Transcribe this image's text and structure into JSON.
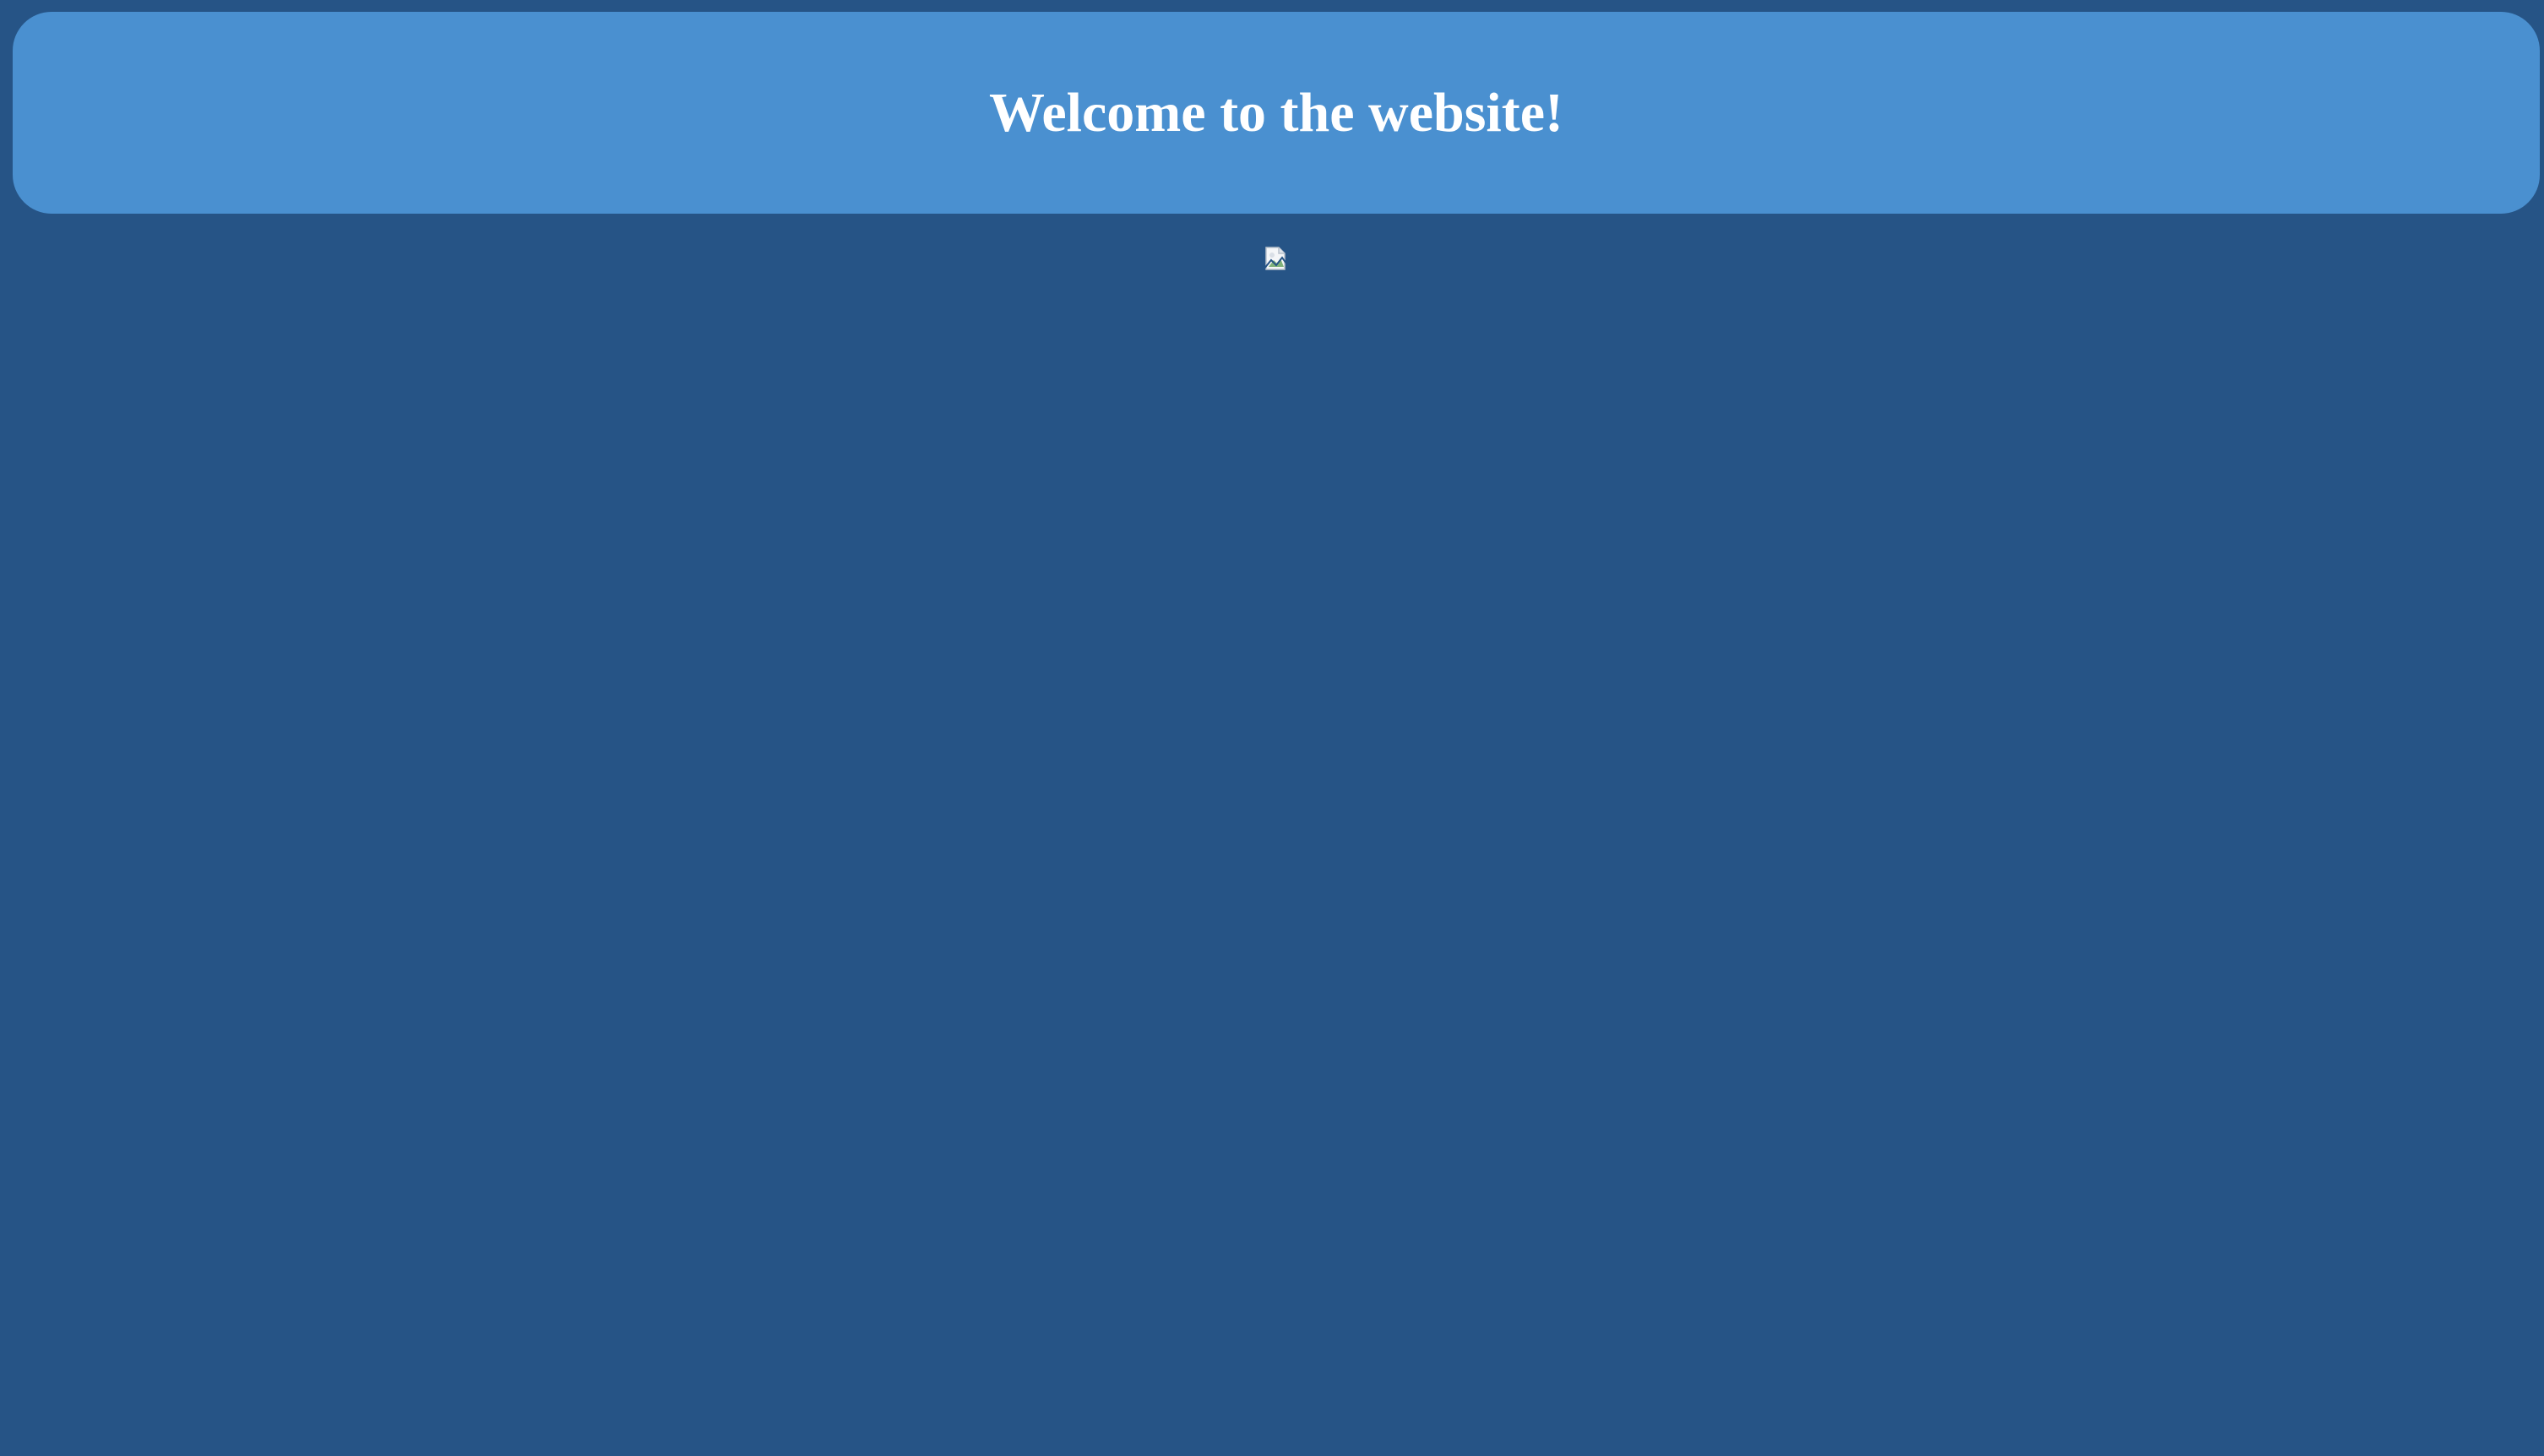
{
  "colors": {
    "page_background": "#265486",
    "header_background": "#4a90d0",
    "title_text": "#ffffff"
  },
  "header": {
    "title": "Welcome to the website!"
  },
  "content": {
    "image_icon": "broken-image-icon"
  }
}
